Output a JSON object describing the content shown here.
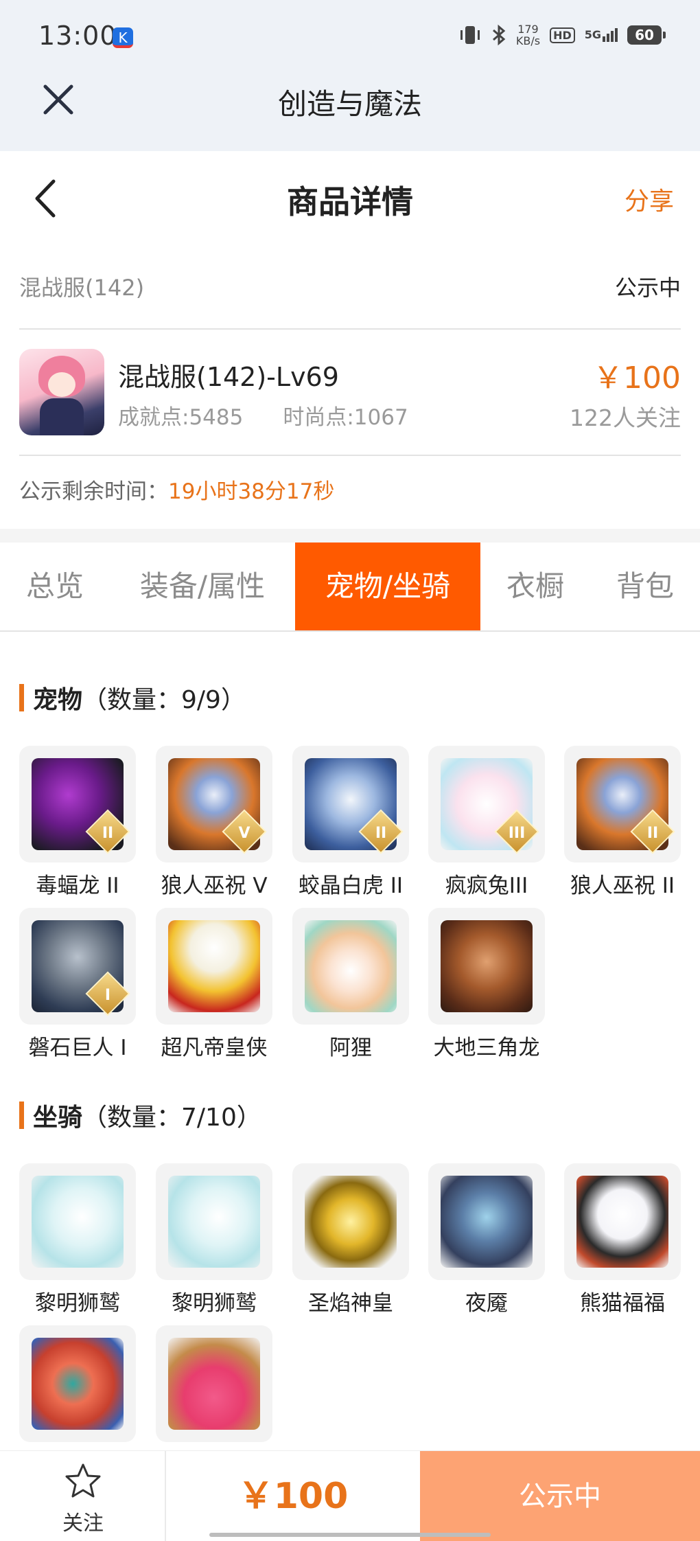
{
  "status_bar": {
    "time": "13:00",
    "app_badge": "K",
    "net_speed_value": "179",
    "net_speed_unit": "KB/s",
    "hd_label": "HD",
    "signal_label": "5G",
    "battery": "60"
  },
  "app_bar": {
    "title": "创造与魔法"
  },
  "page_header": {
    "title": "商品详情",
    "share_label": "分享"
  },
  "server_row": {
    "server": "混战服(142)",
    "status": "公示中"
  },
  "product": {
    "title": "混战服(142)-Lv69",
    "achievement": "成就点:5485",
    "fashion": "时尚点:1067",
    "price": "￥100",
    "followers": "122人关注"
  },
  "remain": {
    "label": "公示剩余时间：",
    "value": "19小时38分17秒"
  },
  "tabs": [
    {
      "label": "总览"
    },
    {
      "label": "装备/属性"
    },
    {
      "label": "宠物/坐骑"
    },
    {
      "label": "衣橱"
    },
    {
      "label": "背包"
    }
  ],
  "active_tab": "宠物/坐骑",
  "pets": {
    "title": "宠物",
    "count": "（数量：9/9）",
    "items": [
      {
        "name": "毒蝠龙 II",
        "badge": "II",
        "icon": "dragon-pet-icon"
      },
      {
        "name": "狼人巫祝 V",
        "badge": "V",
        "icon": "werewolf-pet-icon"
      },
      {
        "name": "蛟晶白虎 II",
        "badge": "II",
        "icon": "white-tiger-pet-icon"
      },
      {
        "name": "疯疯兔III",
        "badge": "III",
        "icon": "rabbit-pet-icon"
      },
      {
        "name": "狼人巫祝 II",
        "badge": "II",
        "icon": "werewolf-pet-icon"
      },
      {
        "name": "磐石巨人 I",
        "badge": "I",
        "icon": "stone-giant-pet-icon"
      },
      {
        "name": "超凡帝皇侠",
        "badge": "",
        "icon": "emperor-pet-icon"
      },
      {
        "name": "阿狸",
        "badge": "",
        "icon": "ali-pet-icon"
      },
      {
        "name": "大地三角龙",
        "badge": "",
        "icon": "triceratops-pet-icon"
      }
    ]
  },
  "mounts": {
    "title": "坐骑",
    "count": "（数量：7/10）",
    "items": [
      {
        "name": "黎明狮鹫",
        "icon": "griffin-mount-icon"
      },
      {
        "name": "黎明狮鹫",
        "icon": "griffin-mount-icon"
      },
      {
        "name": "圣焰神皇",
        "icon": "golden-phoenix-mount-icon"
      },
      {
        "name": "夜魇",
        "icon": "nightmare-mount-icon"
      },
      {
        "name": "熊猫福福",
        "icon": "panda-mount-icon"
      },
      {
        "name": "",
        "icon": "fish-mount-icon"
      },
      {
        "name": "",
        "icon": "basket-mount-icon"
      }
    ]
  },
  "bottom_bar": {
    "follow_label": "关注",
    "price": "￥100",
    "status": "公示中"
  },
  "colors": {
    "accent": "#e8731a",
    "active_tab": "#ff5a00",
    "status_button": "#fda373"
  }
}
